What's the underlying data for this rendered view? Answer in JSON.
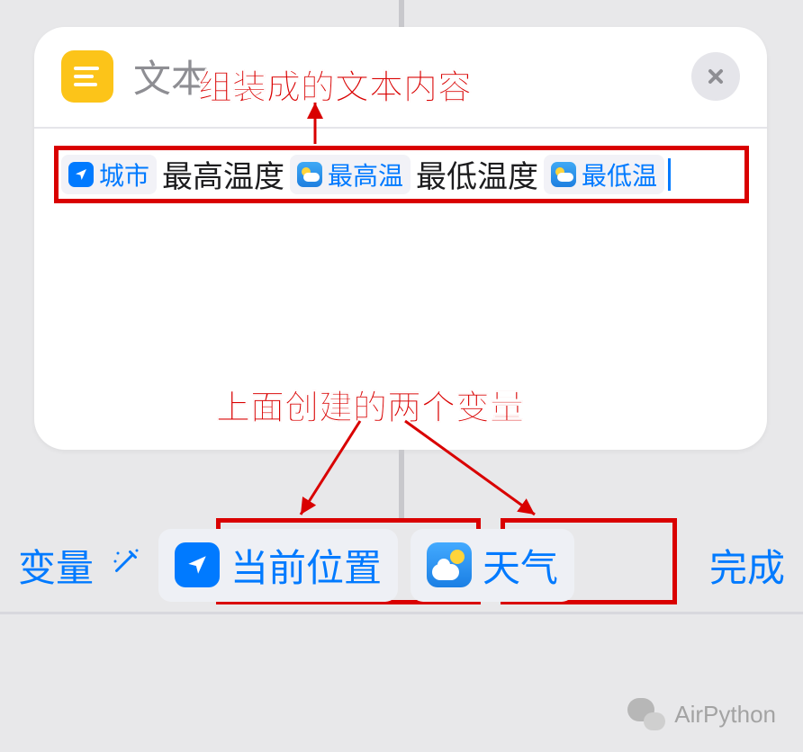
{
  "card": {
    "header_label": "文本",
    "tokens": [
      {
        "type": "var",
        "icon": "location",
        "label": "城市"
      },
      {
        "type": "text",
        "label": "最高温度"
      },
      {
        "type": "var",
        "icon": "weather",
        "label": "最高温"
      },
      {
        "type": "text",
        "label": "最低温度"
      },
      {
        "type": "var",
        "icon": "weather",
        "label": "最低温"
      }
    ]
  },
  "annotations": {
    "top_label": "组装成的文本内容",
    "bottom_label": "上面创建的两个变量"
  },
  "toolbar": {
    "var_label": "变量",
    "chips": [
      {
        "icon": "location",
        "label": "当前位置"
      },
      {
        "icon": "weather",
        "label": "天气"
      }
    ],
    "done_label": "完成"
  },
  "watermark": {
    "label": "AirPython"
  }
}
